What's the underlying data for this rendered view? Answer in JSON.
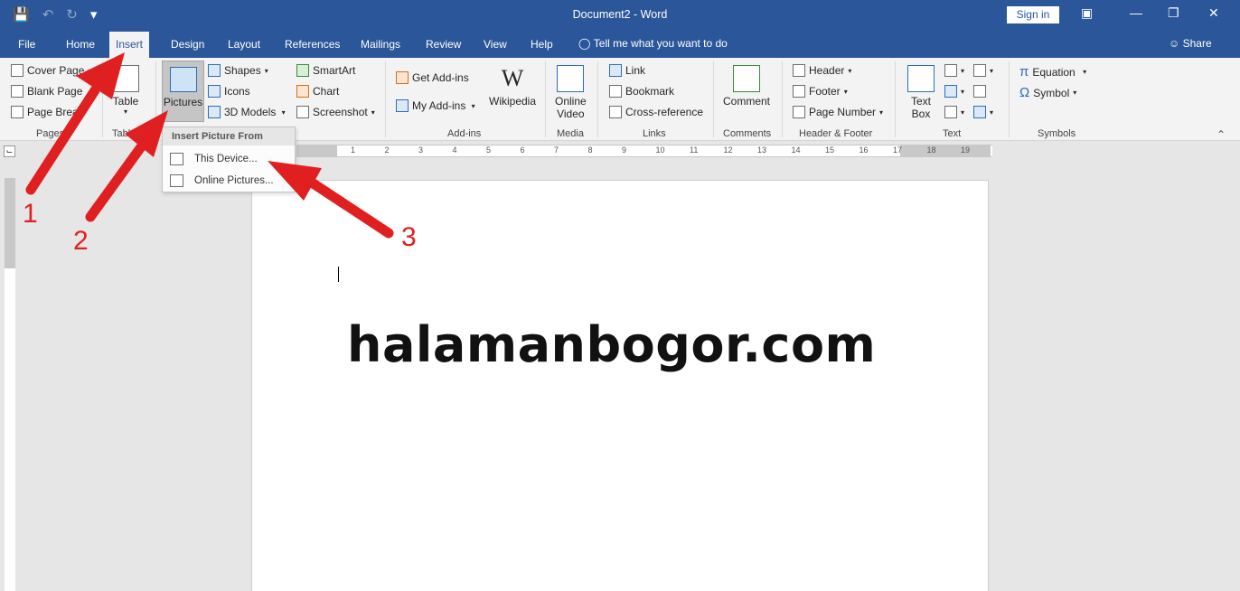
{
  "window": {
    "title": "Document2 - Word",
    "sign_in": "Sign in",
    "controls": [
      "ribbon-display",
      "minimize",
      "restore",
      "close"
    ]
  },
  "tabs": [
    "File",
    "Home",
    "Insert",
    "Design",
    "Layout",
    "References",
    "Mailings",
    "Review",
    "View",
    "Help"
  ],
  "active_tab": "Insert",
  "tell_me": "Tell me what you want to do",
  "share": "Share",
  "ribbon": {
    "pages": {
      "cover_page": "Cover Page",
      "blank_page": "Blank Page",
      "page_break": "Page Break",
      "label": "Pages"
    },
    "tables": {
      "table": "Table",
      "label": "Tables"
    },
    "illustrations": {
      "pictures": "Pictures",
      "shapes": "Shapes",
      "icons": "Icons",
      "models": "3D Models",
      "smartart": "SmartArt",
      "chart": "Chart",
      "screenshot": "Screenshot"
    },
    "addins": {
      "get": "Get Add-ins",
      "my": "My Add-ins",
      "wikipedia": "Wikipedia",
      "label": "Add-ins"
    },
    "media": {
      "online_video_1": "Online",
      "online_video_2": "Video",
      "label": "Media"
    },
    "links": {
      "link": "Link",
      "bookmark": "Bookmark",
      "cross_reference": "Cross-reference",
      "label": "Links"
    },
    "comments": {
      "comment": "Comment",
      "label": "Comments"
    },
    "header_footer": {
      "header": "Header",
      "footer": "Footer",
      "page_number": "Page Number",
      "label": "Header & Footer"
    },
    "text": {
      "text_box_1": "Text",
      "text_box_2": "Box",
      "label": "Text"
    },
    "symbols": {
      "equation": "Equation",
      "symbol": "Symbol",
      "label": "Symbols"
    }
  },
  "pictures_menu": {
    "header": "Insert Picture From",
    "items": [
      "This Device...",
      "Online Pictures..."
    ]
  },
  "ruler_numbers": [
    "1",
    "2",
    "3",
    "4",
    "5",
    "6",
    "7",
    "8",
    "9",
    "10",
    "11",
    "12",
    "13",
    "14",
    "15",
    "16",
    "17",
    "18",
    "19"
  ],
  "document": {
    "text": "halamanbogor.com"
  },
  "annotations": [
    "1",
    "2",
    "3"
  ],
  "colors": {
    "brand": "#2b579a",
    "ribbon": "#f3f3f3",
    "arrow": "#e02020"
  }
}
